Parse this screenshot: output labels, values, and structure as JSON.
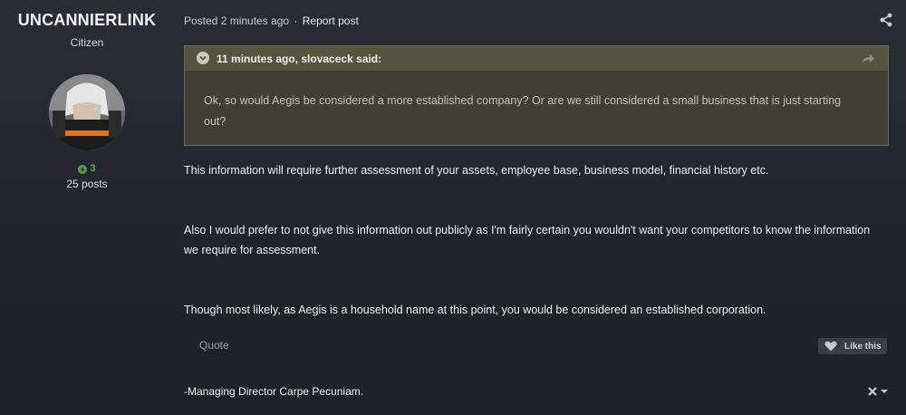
{
  "author": {
    "username": "UNCANNIERLINK",
    "rank": "Citizen",
    "reputation": "3",
    "posts": "25 posts"
  },
  "post_meta": {
    "posted": "Posted 2 minutes ago",
    "separator": "·",
    "report": "Report post"
  },
  "quote": {
    "citation": "11 minutes ago, slovaceck said:",
    "body": "Ok, so would Aegis be considered a more established company? Or are we still considered a small business that is just starting out?"
  },
  "content": {
    "paragraphs": [
      "This information will require further assessment of your assets, employee base, business model, financial history etc.",
      "Also I would prefer to not give this information out publicly as I'm fairly certain you wouldn't want your competitors to know the information we require for assessment.",
      "Though most likely, as Aegis is a household name at this point, you would be considered an established corporation."
    ]
  },
  "actions": {
    "quote": "Quote",
    "like": "Like this"
  },
  "signature": "-Managing Director Carpe Pecuniam.",
  "icons": {
    "share": "share-icon",
    "quote_toggle": "chevron-down-icon",
    "quote_goto": "forward-arrow-icon",
    "like": "heart-icon",
    "signature_close": "close-icon"
  },
  "colors": {
    "background": "#252730",
    "quote_background": "#3f3f35",
    "quote_header": "#55553f",
    "reputation_green": "#6ab04c"
  }
}
